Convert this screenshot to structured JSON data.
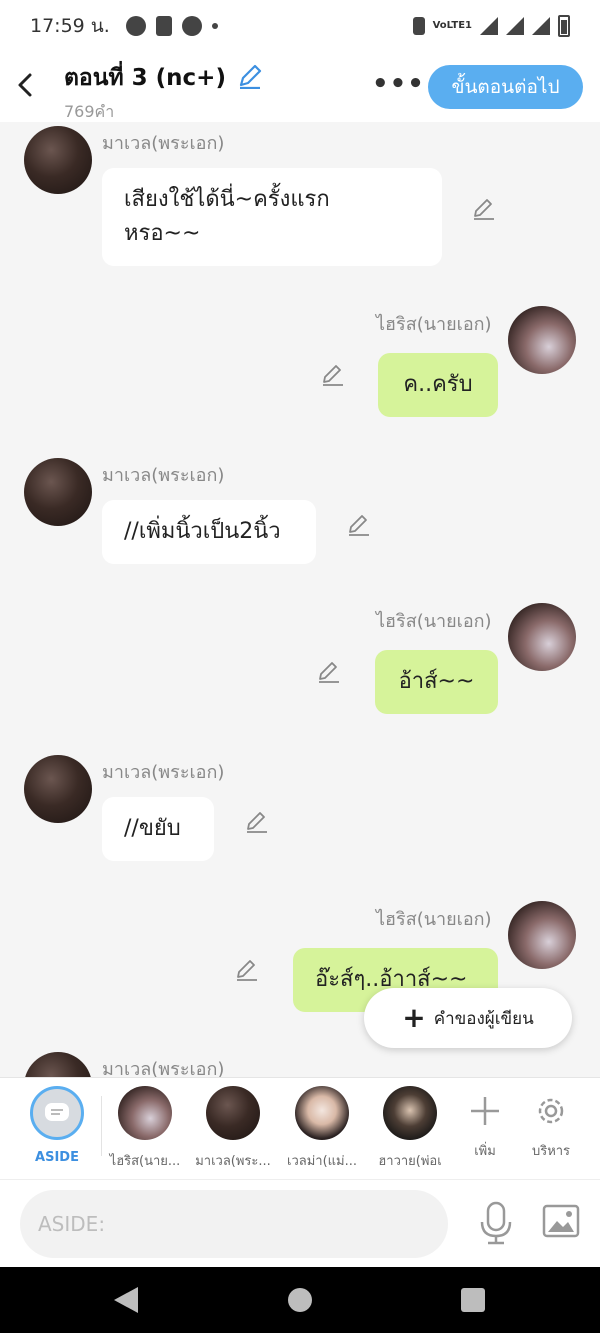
{
  "status": {
    "time": "17:59 น.",
    "network": "VoLTE1"
  },
  "header": {
    "back_icon": "chevron-left-icon",
    "title": "ตอนที่ 3 (nc+)",
    "word_count": "769คำ",
    "more_label": "•••",
    "next_label": "ขั้นตอนต่อไป"
  },
  "messages": [
    {
      "side": "left",
      "name": "มาเวล(พระเอก)",
      "text": "เสียงใช้ได้นี่~ครั้งแรก\nหรอ~~"
    },
    {
      "side": "right",
      "name": "ไฮริส(นายเอก)",
      "text": "ค..ครับ"
    },
    {
      "side": "left",
      "name": "มาเวล(พระเอก)",
      "text": "//เพิ่มนิ้วเป็น2นิ้ว"
    },
    {
      "side": "right",
      "name": "ไฮริส(นายเอก)",
      "text": "อ้าส์~~"
    },
    {
      "side": "left",
      "name": "มาเวล(พระเอก)",
      "text": "//ขยับ"
    },
    {
      "side": "right",
      "name": "ไฮริส(นายเอก)",
      "text": "อ๊ะส์ๆ..อ้าาส์~~"
    },
    {
      "side": "left",
      "name": "มาเวล(พระเอก)"
    }
  ],
  "author_note": {
    "label": "คำของผู้เขียน"
  },
  "characters": [
    {
      "label": "ASIDE"
    },
    {
      "label": "ไฮริส(นาย..."
    },
    {
      "label": "มาเวล(พระ..."
    },
    {
      "label": "เวลม่า(แม่..."
    },
    {
      "label": "ฮาวาย(พ่อเ"
    }
  ],
  "tools": {
    "add_label": "เพิ่ม",
    "manage_label": "บริหาร"
  },
  "input": {
    "placeholder": "ASIDE:",
    "value": ""
  },
  "colors": {
    "accent": "#5aaef0",
    "bubble_right": "#d6f39a",
    "bubble_left": "#ffffff",
    "background": "#f5f5f5"
  }
}
